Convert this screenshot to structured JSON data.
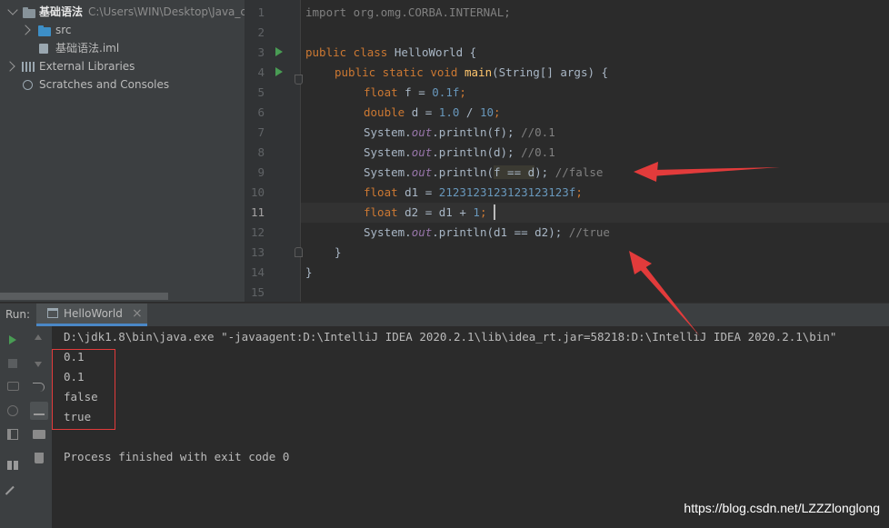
{
  "project_tree": {
    "root_name": "基础语法",
    "root_path": "C:\\Users\\WIN\\Desktop\\Java_c",
    "items": [
      {
        "label": "src"
      },
      {
        "label": "基础语法.iml"
      },
      {
        "label": "External Libraries"
      },
      {
        "label": "Scratches and Consoles"
      }
    ]
  },
  "editor": {
    "line_numbers": [
      "1",
      "2",
      "3",
      "4",
      "5",
      "6",
      "7",
      "8",
      "9",
      "10",
      "11",
      "12",
      "13",
      "14",
      "15"
    ],
    "current_line": "11",
    "code": {
      "l1": "import org.omg.CORBA.INTERNAL;",
      "l3_kw": "public class ",
      "l3_name": "HelloWorld {",
      "l4_kw": "public static void ",
      "l4_fn": "main",
      "l4_rest": "(String[] args) {",
      "l5_kw": "float ",
      "l5_a": "f = ",
      "l5_num": "0.1f",
      "l5_b": ";",
      "l6_kw": "double ",
      "l6_a": "d = ",
      "l6_n1": "1.0",
      "l6_b": " / ",
      "l6_n2": "10",
      "l6_c": ";",
      "sys": "System.",
      "out": "out",
      "println": ".println(",
      "l7_arg": "f); ",
      "l7_cm": "//0.1",
      "l8_arg": "d); ",
      "l8_cm": "//0.1",
      "l9_hl": "f == d",
      "l9_rest": "); ",
      "l9_cm": "//false",
      "l10_kw": "float ",
      "l10_a": "d1 = ",
      "l10_num": "2123123123123123123f",
      "l10_b": ";",
      "l11_kw": "float ",
      "l11_a": "d2 = d1 + ",
      "l11_num": "1",
      "l11_b": ";",
      "l12_arg": "d1 == d2); ",
      "l12_cm": "//true",
      "l13": "}",
      "l14": "}"
    }
  },
  "run_panel": {
    "label": "Run:",
    "tab_label": "HelloWorld",
    "close_glyph": "×",
    "console_lines": [
      "D:\\jdk1.8\\bin\\java.exe \"-javaagent:D:\\IntelliJ IDEA 2020.2.1\\lib\\idea_rt.jar=58218:D:\\IntelliJ IDEA 2020.2.1\\bin\"",
      "0.1",
      "0.1",
      "false",
      "true",
      "",
      "Process finished with exit code 0"
    ]
  },
  "watermark": "https://blog.csdn.net/LZZZlonglong",
  "colors": {
    "keyword": "#cc7832",
    "number": "#6897bb",
    "comment": "#808080",
    "function": "#ffc66d",
    "static_field": "#9876aa",
    "annotation_arrow": "#e23b3b",
    "run_green": "#499c54"
  }
}
